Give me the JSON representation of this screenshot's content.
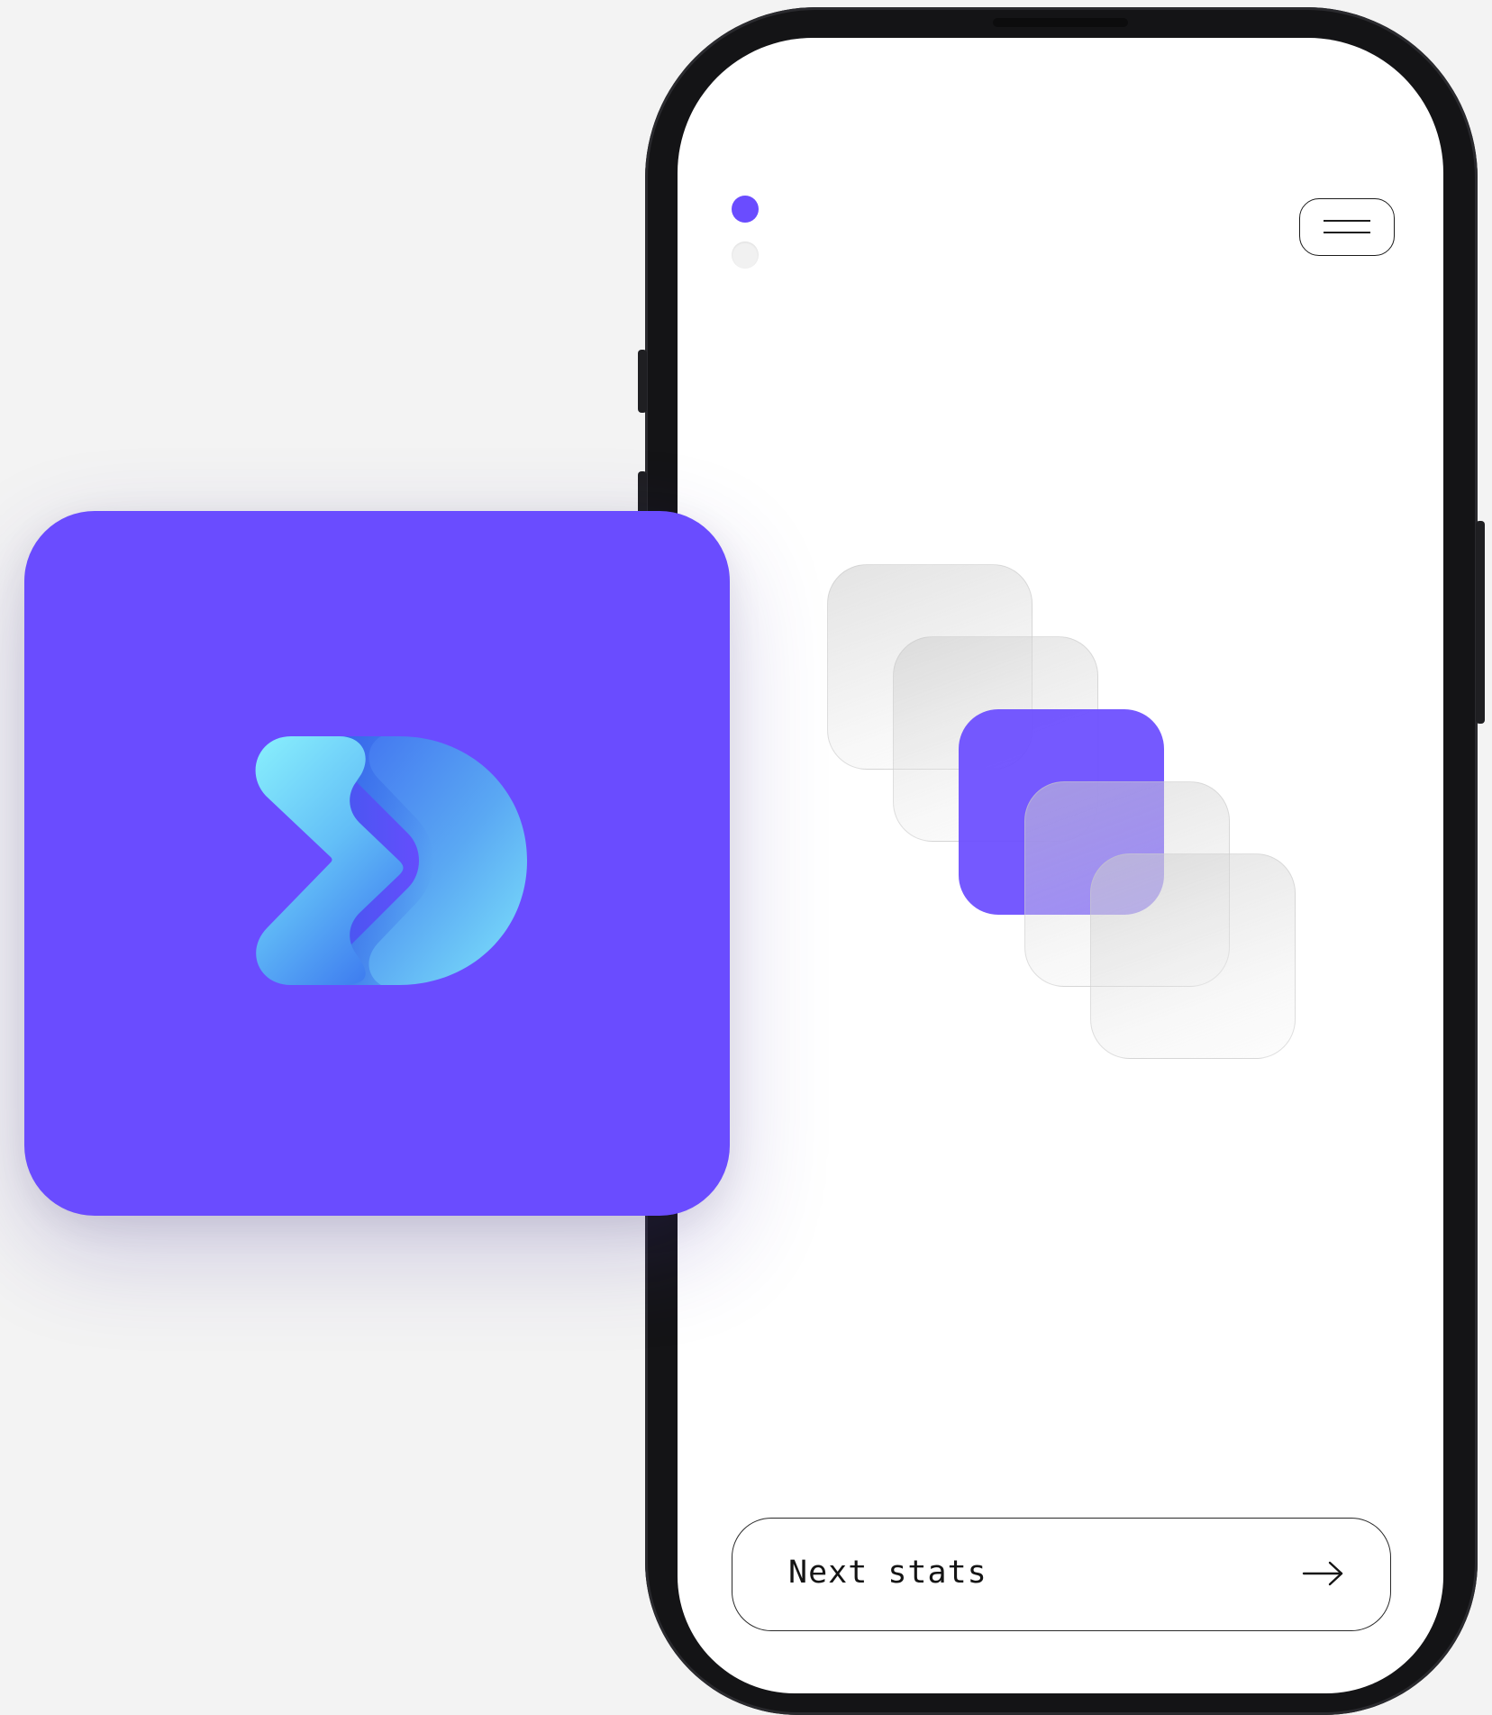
{
  "onboarding": {
    "pagination": {
      "total": 2,
      "active_index": 0
    },
    "menu_icon": "menu-icon",
    "next_button": {
      "label": "Next stats",
      "icon": "arrow-right-icon"
    }
  },
  "logo": {
    "icon": "app-logo-icon"
  },
  "colors": {
    "accent": "#6a4cff",
    "logo_gradient_light": "#7ee4fb",
    "logo_gradient_dark": "#3f7ef0",
    "background": "#f3f3f3",
    "phone_frame": "#141416",
    "screen": "#ffffff"
  }
}
